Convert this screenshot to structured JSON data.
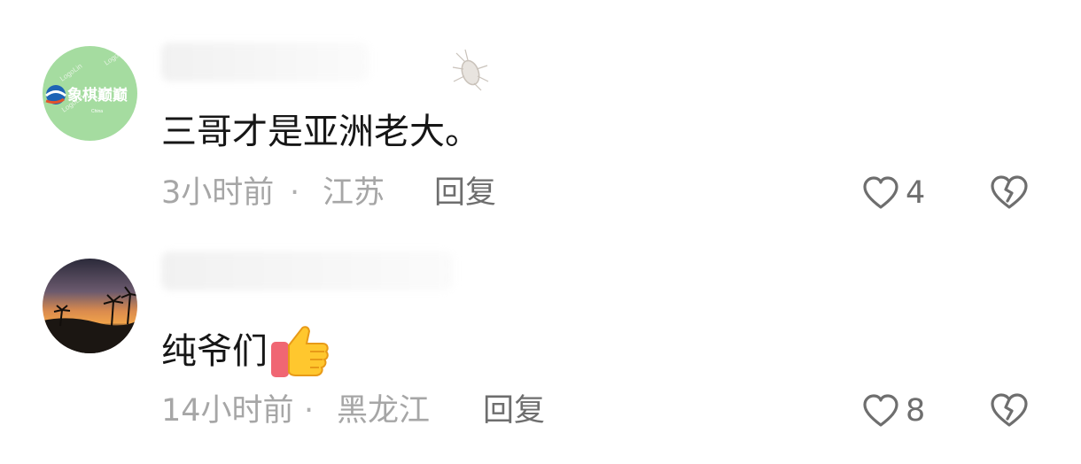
{
  "comments": [
    {
      "avatar_icon": "chess-logo-avatar-icon",
      "avatar_text": "象棋巅巅",
      "text": "三哥才是亚洲老大。",
      "time": "3小时前",
      "separator": "·",
      "location": "江苏",
      "reply_label": "回复",
      "likes": "4"
    },
    {
      "avatar_icon": "sunset-palm-avatar-icon",
      "text": "纯爷们",
      "emoji": "thumbs-up-icon",
      "time": "14小时前",
      "separator": "·",
      "location": "黑龙江",
      "reply_label": "回复",
      "likes": "8"
    }
  ],
  "colors": {
    "text": "#161616",
    "meta": "#a6a6a6",
    "action": "#6e6e6e",
    "avatar1_bg": "#a5dca0"
  }
}
